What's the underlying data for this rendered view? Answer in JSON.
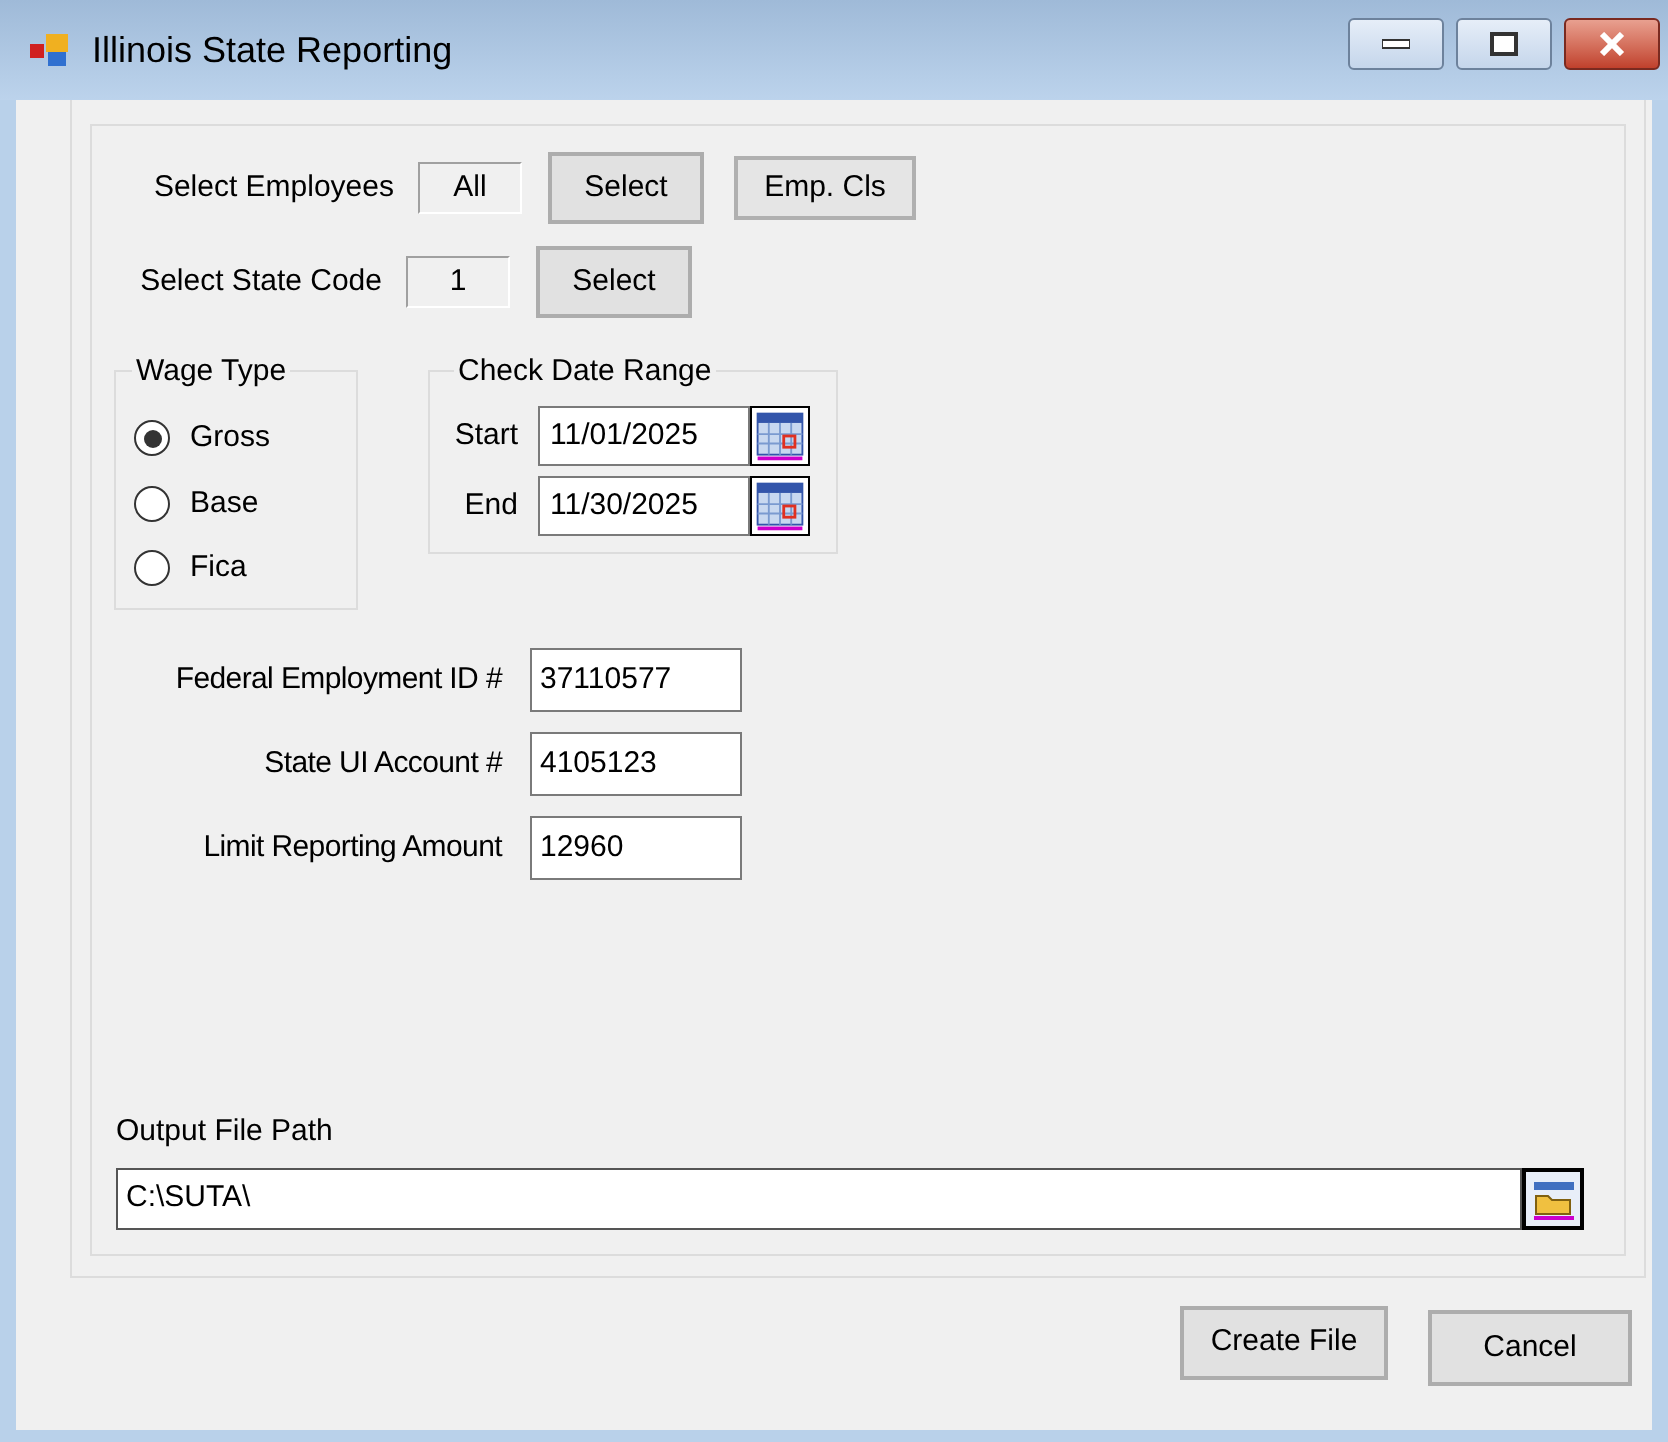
{
  "window": {
    "title": "Illinois State Reporting"
  },
  "select_employees": {
    "label": "Select Employees",
    "value": "All",
    "buttons": [
      "Select",
      "Emp. Cls"
    ]
  },
  "select_state_code": {
    "label": "Select State Code",
    "value": "1",
    "buttons": [
      "Select"
    ]
  },
  "wage_type": {
    "title": "Wage Type",
    "options": [
      {
        "label": "Gross",
        "selected": true
      },
      {
        "label": "Base",
        "selected": false
      },
      {
        "label": "Fica",
        "selected": false
      }
    ]
  },
  "check_date_range": {
    "title": "Check Date Range",
    "fields": [
      {
        "label": "Start",
        "value": "11/01/2025"
      },
      {
        "label": "End",
        "value": "11/30/2025"
      }
    ]
  },
  "fields": [
    {
      "label": "Federal Employment ID #",
      "value": "37110577"
    },
    {
      "label": "State UI Account #",
      "value": "4105123"
    },
    {
      "label": "Limit Reporting Amount",
      "value": "12960"
    }
  ],
  "output_file_path": {
    "label": "Output File Path",
    "value": "C:\\SUTA\\"
  },
  "buttons": [
    "Create File",
    "Cancel"
  ]
}
